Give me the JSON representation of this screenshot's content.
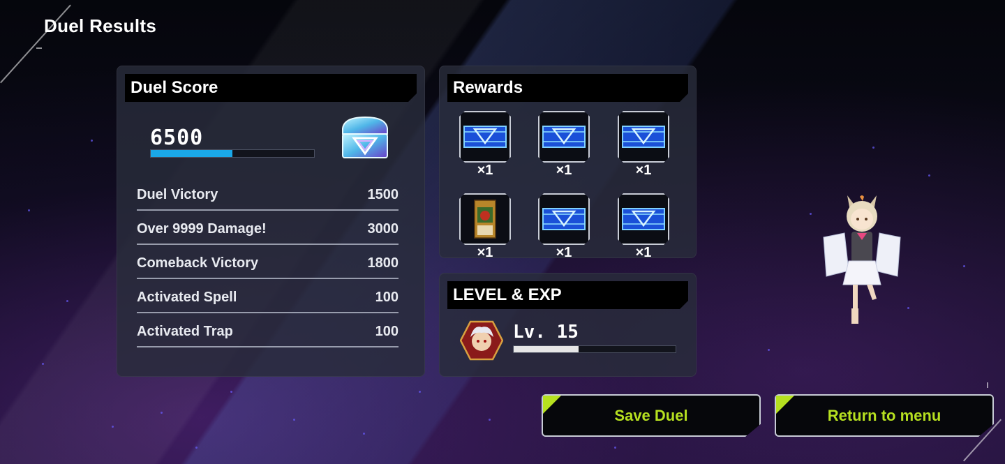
{
  "title": "Duel Results",
  "score": {
    "header": "Duel Score",
    "total": "6500",
    "progress": 0.5,
    "rows": [
      {
        "label": "Duel Victory",
        "value": "1500"
      },
      {
        "label": "Over 9999 Damage!",
        "value": "3000"
      },
      {
        "label": "Comeback Victory",
        "value": "1800"
      },
      {
        "label": "Activated Spell",
        "value": "100"
      },
      {
        "label": "Activated Trap",
        "value": "100"
      }
    ]
  },
  "rewards": {
    "header": "Rewards",
    "items": [
      {
        "icon": "card-pack-icon",
        "qty": "×1"
      },
      {
        "icon": "card-pack-icon",
        "qty": "×1"
      },
      {
        "icon": "card-pack-icon",
        "qty": "×1"
      },
      {
        "icon": "monster-card-icon",
        "qty": "×1"
      },
      {
        "icon": "card-pack-icon",
        "qty": "×1"
      },
      {
        "icon": "card-pack-icon",
        "qty": "×1"
      }
    ]
  },
  "level": {
    "header": "LEVEL & EXP",
    "level_text": "Lv. 15",
    "exp_progress": 0.4
  },
  "buttons": {
    "save": "Save Duel",
    "return": "Return to menu"
  },
  "colors": {
    "accent": "#b6e020",
    "score_bar": "#1aa8e8",
    "exp_bar": "#e6e6e6"
  }
}
